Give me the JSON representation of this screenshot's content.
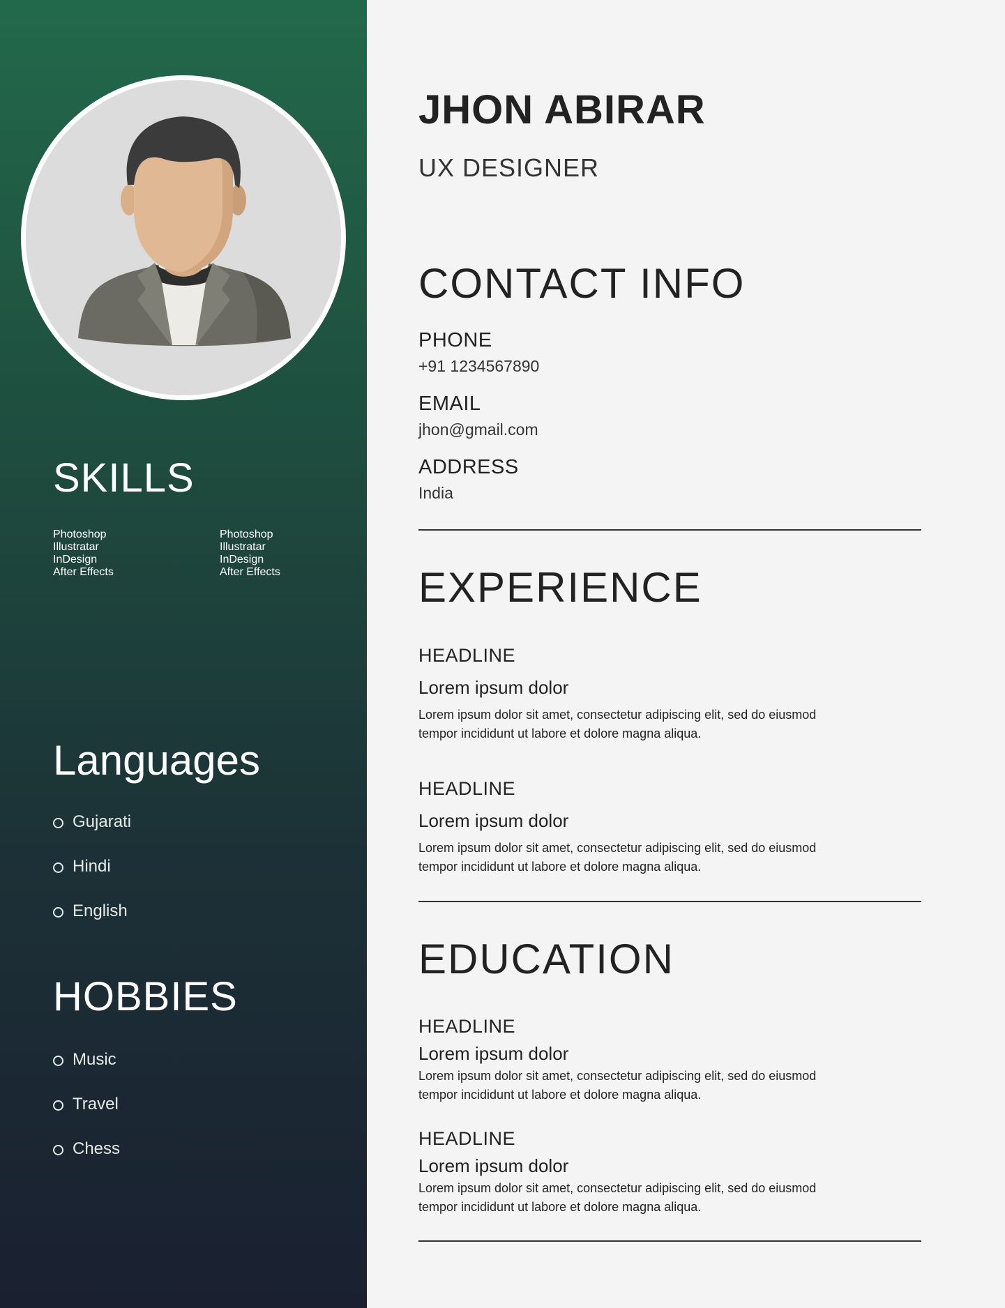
{
  "profile": {
    "name": "JHON ABIRAR",
    "role": "UX DESIGNER"
  },
  "sidebar": {
    "skills_title": "SKILLS",
    "skills_col1": [
      "Photoshop",
      "Illustratar",
      "InDesign",
      "After Effects"
    ],
    "skills_col2": [
      "Photoshop",
      "Illustratar",
      "InDesign",
      "After Effects"
    ],
    "languages_title": "Languages",
    "languages": [
      "Gujarati",
      "Hindi",
      "English"
    ],
    "hobbies_title": "HOBBIES",
    "hobbies": [
      "Music",
      "Travel",
      "Chess"
    ]
  },
  "contact": {
    "title": "CONTACT INFO",
    "phone_label": "PHONE",
    "phone": "+91 1234567890",
    "email_label": "EMAIL",
    "email": "jhon@gmail.com",
    "address_label": "ADDRESS",
    "address": "India"
  },
  "experience": {
    "title": "EXPERIENCE",
    "items": [
      {
        "headline": "HEADLINE",
        "title": "Lorem ipsum dolor",
        "desc": "Lorem ipsum dolor sit amet, consectetur adipiscing elit, sed do eiusmod tempor incididunt ut labore et dolore magna aliqua."
      },
      {
        "headline": "HEADLINE",
        "title": "Lorem ipsum dolor",
        "desc": "Lorem ipsum dolor sit amet, consectetur adipiscing elit, sed do eiusmod tempor incididunt ut labore et dolore magna aliqua."
      }
    ]
  },
  "education": {
    "title": "EDUCATION",
    "items": [
      {
        "headline": "HEADLINE",
        "title": "Lorem ipsum dolor",
        "desc": "Lorem ipsum dolor sit amet, consectetur adipiscing elit, sed do eiusmod tempor incididunt ut labore et dolore magna aliqua."
      },
      {
        "headline": "HEADLINE",
        "title": "Lorem ipsum dolor",
        "desc": "Lorem ipsum dolor sit amet, consectetur adipiscing elit, sed do eiusmod tempor incididunt ut labore et dolore magna aliqua."
      }
    ]
  },
  "colors": {
    "sidebar_top": "#22694b",
    "sidebar_bottom": "#1a2030",
    "page_background": "#f4f4f4",
    "text_dark": "#222222"
  },
  "icons": {
    "avatar": "person-avatar-icon",
    "bullet": "circle-bullet-icon"
  }
}
